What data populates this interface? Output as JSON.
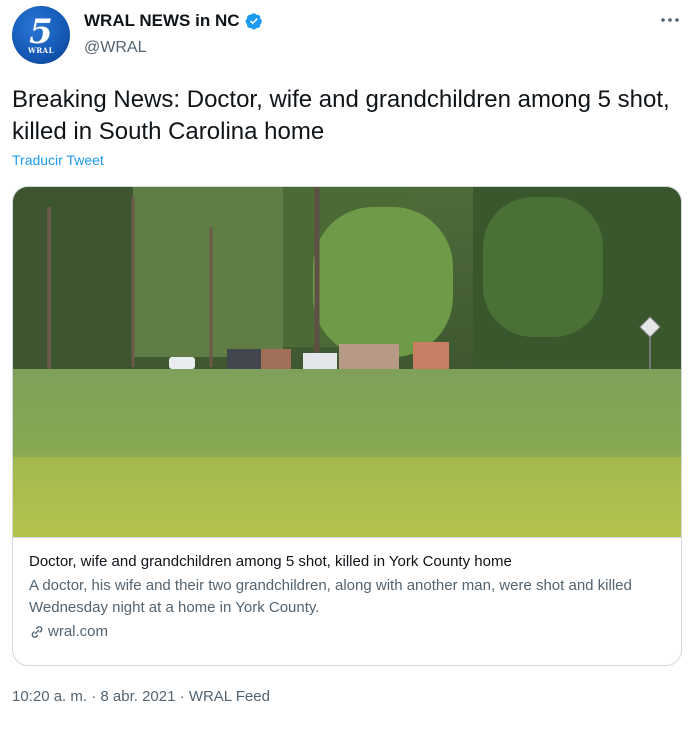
{
  "account": {
    "display_name": "WRAL NEWS in NC",
    "handle": "@WRAL",
    "avatar_number": "5",
    "avatar_sub": "WRAL",
    "verified": true
  },
  "tweet": {
    "text": "Breaking News: Doctor, wife and grandchildren among 5 shot, killed in South Carolina home",
    "translate_label": "Traducir Tweet"
  },
  "card": {
    "title": "Doctor, wife and grandchildren among 5 shot, killed in York County home",
    "description": "A doctor, his wife and their two grandchildren, along with another man, were shot and killed Wednesday night at a home in York County.",
    "domain": "wral.com"
  },
  "meta": {
    "time": "10:20 a. m.",
    "sep1": " · ",
    "date": "8 abr. 2021",
    "sep2": " · ",
    "source": "WRAL Feed"
  },
  "icons": {
    "more": "more-horizontal-icon",
    "verified": "verified-badge-icon",
    "link": "link-icon"
  },
  "colors": {
    "accent": "#1d9bf0",
    "secondary_text": "#536471",
    "avatar_blue": "#1457b4"
  }
}
